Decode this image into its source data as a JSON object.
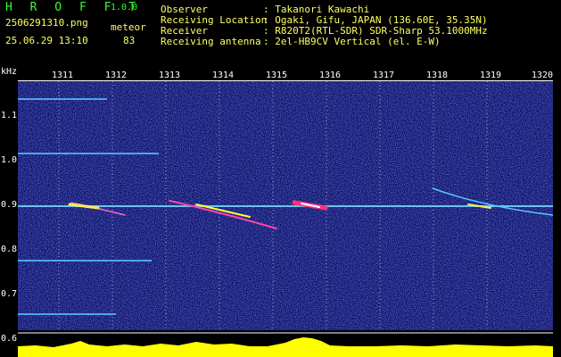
{
  "header": {
    "app_name": "H R O F F T",
    "version": "1.0.0",
    "filename": "2506291310.png",
    "datetime": "25.06.29 13:10",
    "mode_label": "meteor",
    "meteor_count": "83",
    "info_rows": [
      {
        "label": "Observer",
        "value": ": Takanori Kawachi"
      },
      {
        "label": "Receiving Location",
        "value": ": Ogaki, Gifu, JAPAN (136.60E, 35.35N)"
      },
      {
        "label": "Receiver",
        "value": ": R820T2(RTL-SDR) SDR-Sharp 53.1000MHz"
      },
      {
        "label": "Receiving antenna",
        "value": ": 2el-HB9CV Vertical (el. E-W)"
      }
    ]
  },
  "axis": {
    "y_unit": "kHz",
    "y_ticks": [
      "1.1",
      "1.0",
      "0.9",
      "0.8",
      "0.7",
      "0.6"
    ],
    "x_ticks": [
      "1311",
      "1312",
      "1313",
      "1314",
      "1315",
      "1316",
      "1317",
      "1318",
      "1319",
      "1320"
    ]
  },
  "colors": {
    "background": "#000000",
    "spectrogram_bg": "#0c0c66",
    "carrier": "#66ccff",
    "level_bars": "#ffff00"
  }
}
